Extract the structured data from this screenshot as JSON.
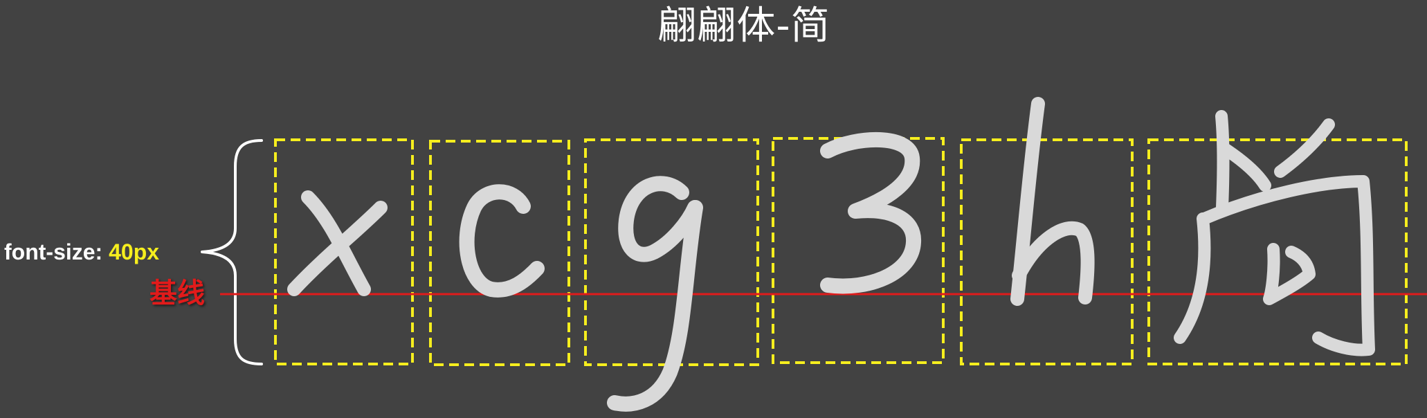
{
  "title": "翩翩体-简",
  "font_size_label": {
    "prefix": "font-size: ",
    "value": "40px"
  },
  "baseline_label": "基线",
  "glyphs": [
    "x",
    "c",
    "g",
    "3",
    "h",
    "尚"
  ],
  "colors": {
    "background": "#424242",
    "box_outline": "#f6ee1e",
    "baseline": "#e11b1b",
    "glyph": "#d9d9d9",
    "text": "#ffffff"
  }
}
